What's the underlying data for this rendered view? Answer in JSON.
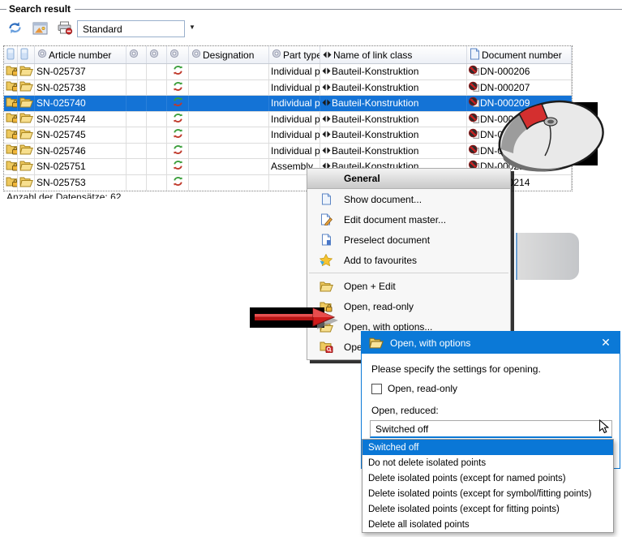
{
  "groupbox": {
    "title": "Search result"
  },
  "toolbar": {
    "buttons": [
      {
        "icon": "refresh-icon"
      },
      {
        "icon": "result-view-icon"
      },
      {
        "icon": "print-icon"
      }
    ],
    "profile_combo": {
      "value": "Standard"
    }
  },
  "table": {
    "columns": [
      {
        "label": "",
        "icon": "column-bar-icon"
      },
      {
        "label": "",
        "icon": "column-bar-icon"
      },
      {
        "label": "Article number",
        "icon": "gear-icon"
      },
      {
        "label": "",
        "icon": "gear-icon"
      },
      {
        "label": "",
        "icon": "gear-icon"
      },
      {
        "label": "",
        "icon": "gear-icon"
      },
      {
        "label": "Designation",
        "icon": "gear-icon"
      },
      {
        "label": "Part type",
        "icon": "gear-icon"
      },
      {
        "label": "Name of link class",
        "icon": "link-arrows-icon"
      },
      {
        "label": "Document number",
        "icon": "document-icon"
      }
    ],
    "rows": [
      {
        "article_number": "SN-025737",
        "part_type": "Individual part",
        "link_class": "Bauteil-Konstruktion",
        "document_number": "DN-000206",
        "selected": false
      },
      {
        "article_number": "SN-025738",
        "part_type": "Individual part",
        "link_class": "Bauteil-Konstruktion",
        "document_number": "DN-000207",
        "selected": false
      },
      {
        "article_number": "SN-025740",
        "part_type": "Individual part",
        "link_class": "Bauteil-Konstruktion",
        "document_number": "DN-000209",
        "selected": true
      },
      {
        "article_number": "SN-025744",
        "part_type": "Individual part",
        "link_class": "Bauteil-Konstruktion",
        "document_number": "DN-000210",
        "selected": false
      },
      {
        "article_number": "SN-025745",
        "part_type": "Individual part",
        "link_class": "Bauteil-Konstruktion",
        "document_number": "DN-000211",
        "selected": false
      },
      {
        "article_number": "SN-025746",
        "part_type": "Individual part",
        "link_class": "Bauteil-Konstruktion",
        "document_number": "DN-000212",
        "selected": false
      },
      {
        "article_number": "SN-025751",
        "part_type": "Assembly",
        "link_class": "Bauteil-Konstruktion",
        "document_number": "DN-000213",
        "selected": false
      },
      {
        "article_number": "SN-025753",
        "part_type": "",
        "link_class": "",
        "document_number": "DN-000214",
        "selected": false
      }
    ]
  },
  "status": {
    "record_count_text": "Anzahl der Datensätze: 62"
  },
  "context_menu": {
    "header": "General",
    "groups": [
      {
        "items": [
          {
            "icon": "document-icon",
            "label": "Show document..."
          },
          {
            "icon": "document-edit-icon",
            "label": "Edit document master..."
          },
          {
            "icon": "document-preselect-icon",
            "label": "Preselect document"
          },
          {
            "icon": "favourite-star-icon",
            "label": "Add to favourites"
          }
        ]
      },
      {
        "items": [
          {
            "icon": "folder-open-icon",
            "label": "Open + Edit"
          },
          {
            "icon": "folder-lock-icon",
            "label": "Open, read-only"
          },
          {
            "icon": "folder-open-icon",
            "label": "Open, with options..."
          },
          {
            "icon": "folder-search-icon",
            "label": "Ope"
          }
        ]
      }
    ]
  },
  "dialog": {
    "title": "Open, with options",
    "close_glyph": "✕",
    "message": "Please specify the settings for opening.",
    "checkbox": {
      "label": "Open, read-only",
      "checked": false
    },
    "combo_label": "Open, reduced:",
    "combo_value": "Switched off",
    "dropdown": {
      "selected": "Switched off",
      "options": [
        "Switched off",
        "Do not delete isolated points",
        "Delete isolated points (except for named points)",
        "Delete isolated points (except for symbol/fitting points)",
        "Delete isolated points (except for fitting points)",
        "Delete all isolated points"
      ]
    }
  },
  "colors": {
    "titlebar_blue": "#0b79d7",
    "selection_blue": "#1473d6",
    "highlight_blue": "#0a77d6"
  }
}
